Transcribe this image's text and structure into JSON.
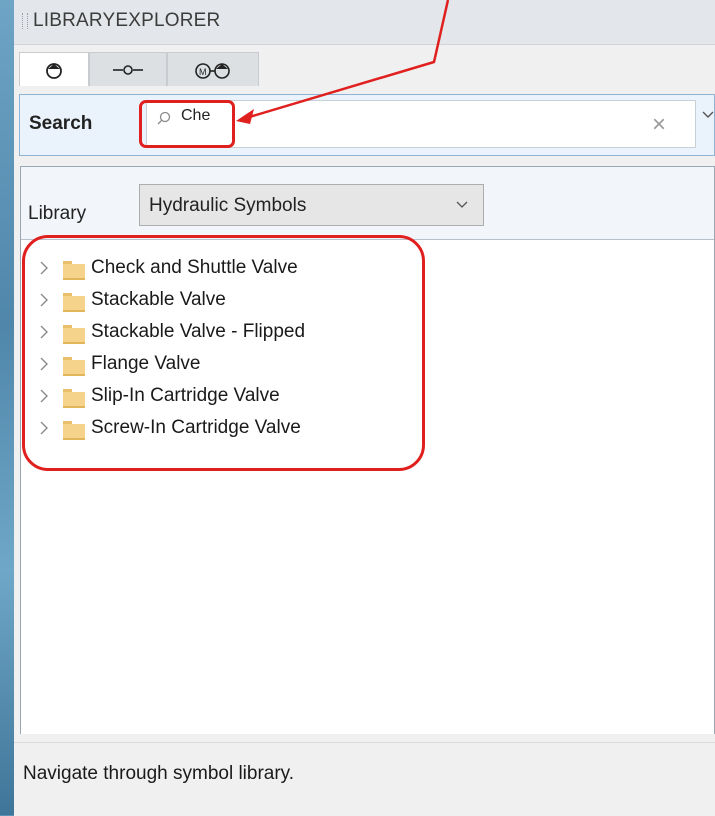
{
  "panel": {
    "title": "LIBRARYEXPLORER"
  },
  "tabs": [
    {
      "icon": "symbol-icon",
      "active": true
    },
    {
      "icon": "line-connector-icon",
      "active": false
    },
    {
      "icon": "motor-pump-icon",
      "active": false
    }
  ],
  "search": {
    "label": "Search",
    "value": "Che"
  },
  "library": {
    "label": "Library",
    "selected": "Hydraulic Symbols"
  },
  "tree": {
    "items": [
      {
        "label": "Check and Shuttle Valve"
      },
      {
        "label": "Stackable Valve"
      },
      {
        "label": "Stackable Valve - Flipped"
      },
      {
        "label": "Flange Valve"
      },
      {
        "label": "Slip-In Cartridge Valve"
      },
      {
        "label": "Screw-In Cartridge Valve"
      }
    ]
  },
  "status": {
    "text": "Navigate through symbol library."
  },
  "colors": {
    "highlight": "#e0201e",
    "folder": "#f5d38a"
  }
}
